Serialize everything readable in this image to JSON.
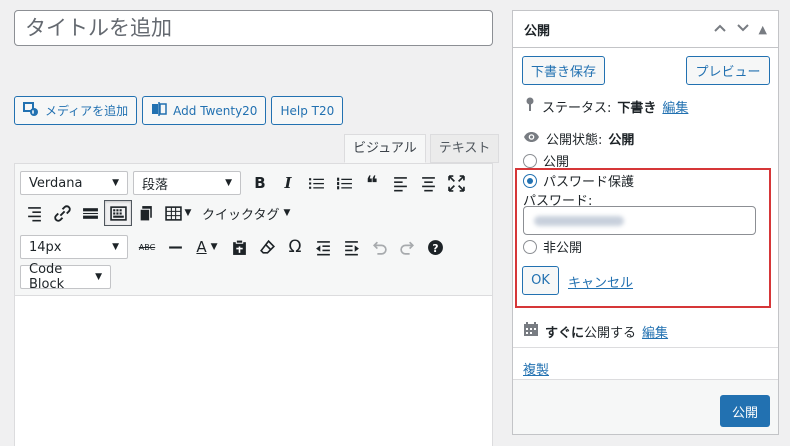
{
  "title_placeholder": "タイトルを追加",
  "media_buttons": {
    "add_media": "メディアを追加",
    "add_twenty": "Add Twenty20",
    "help": "Help T20"
  },
  "editor_tabs": {
    "visual": "ビジュアル",
    "text": "テキスト"
  },
  "toolbar": {
    "font_family": "Verdana",
    "block_format": "段落",
    "quicktags": "クイックタグ",
    "font_size": "14px",
    "code_block": "Code Block"
  },
  "publish_box": {
    "title": "公開",
    "save_draft": "下書き保存",
    "preview": "プレビュー",
    "status_label": "ステータス:",
    "status_value": "下書き",
    "edit": "編集",
    "visibility_label": "公開状態:",
    "visibility_value": "公開",
    "option_public": "公開",
    "option_password": "パスワード保護",
    "password_label": "パスワード:",
    "option_private": "非公開",
    "ok": "OK",
    "cancel": "キャンセル",
    "schedule_bold": "すぐに",
    "schedule_rest": "公開する",
    "schedule_edit": "編集",
    "duplicate": "複製",
    "publish": "公開"
  },
  "colors": {
    "accent": "#2271b1",
    "highlight": "#d63638"
  }
}
